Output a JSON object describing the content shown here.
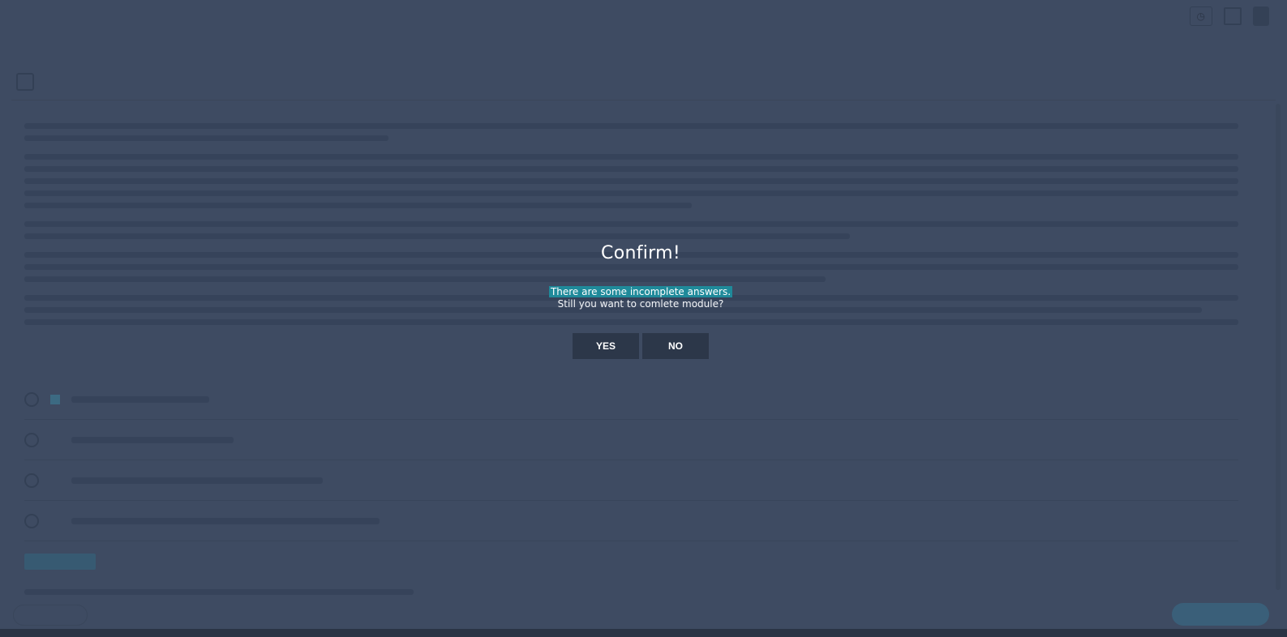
{
  "modal": {
    "title": "Confirm!",
    "message_highlight": "There are some incomplete answers.",
    "message": "Still you want to comlete module?",
    "yes_label": "YES",
    "no_label": "NO"
  },
  "colors": {
    "overlay": "#3e4b62",
    "highlight": "#1f8a9a",
    "button": "#2c3749"
  }
}
